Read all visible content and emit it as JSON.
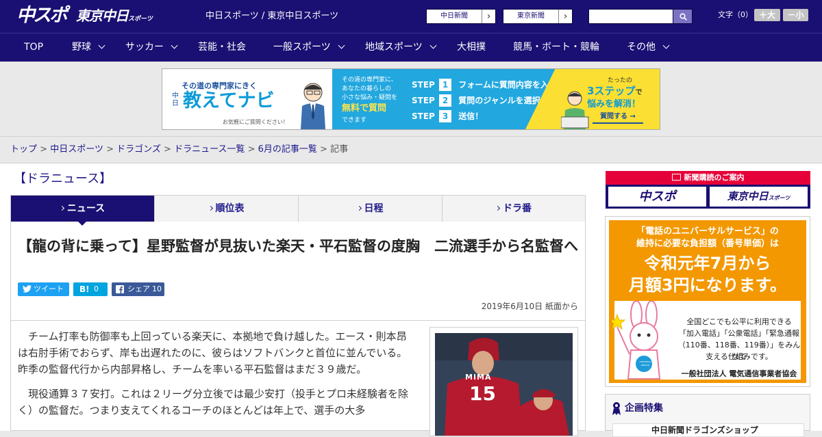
{
  "header": {
    "logo_chuspo": "中スポ",
    "logo_tokyo": "東京中日",
    "logo_tokyo_small": "スポーツ",
    "site_name": "中日スポーツ / 東京中日スポーツ",
    "btn_chunichi": "中日新聞",
    "btn_tokyo": "東京新聞",
    "arrow": "›",
    "search_placeholder": "",
    "font_size_label": "文字（0）",
    "font_bigger": "＋大",
    "font_smaller": "－小"
  },
  "nav": {
    "items": [
      {
        "label": "TOP"
      },
      {
        "label": "野球"
      },
      {
        "label": "サッカー"
      },
      {
        "label": "芸能・社会"
      },
      {
        "label": "一般スポーツ"
      },
      {
        "label": "地域スポーツ"
      },
      {
        "label": "大相撲"
      },
      {
        "label": "競馬・ボート・競輪"
      },
      {
        "label": "その他"
      }
    ]
  },
  "ad": {
    "catch": "その道の専門家にきく",
    "brand_small": "中日",
    "brand": "教えてナビ",
    "note": "お気軽にご質問ください！",
    "desc1": "その道の専門家に、",
    "desc2": "あなたの暮らしの",
    "desc3": "小さな悩み・疑問を",
    "free": "無料で質問",
    "desc4": "できます",
    "step_word": "STEP",
    "step1": "フォームに質問内容を入力",
    "step2": "質問のジャンルを選択",
    "step3": "送信！",
    "right1": "たったの",
    "right2": "3ステップ",
    "right2b": "で",
    "right3": "悩みを解消！",
    "right_btn": "質問する"
  },
  "breadcrumb": {
    "items": [
      "トップ",
      "中日スポーツ",
      "ドラゴンズ",
      "ドラニュース一覧",
      "6月の記事一覧"
    ],
    "current": "記事",
    "sep": ">"
  },
  "section_title": "【ドラニュース】",
  "tabs": [
    {
      "label": "ニュース"
    },
    {
      "label": "順位表"
    },
    {
      "label": "日程"
    },
    {
      "label": "ドラ番"
    }
  ],
  "article": {
    "title": "【龍の背に乗って】星野監督が見抜いた楽天・平石監督の度胸　二流選手から名監督へ",
    "tweet": "ツイート",
    "hatena_label": "B!",
    "hatena_count": "0",
    "share_label": "シェア",
    "share_count": "10",
    "date": "2019年6月10日 紙面から",
    "p1": "チーム打率も防御率も上回っている楽天に、本拠地で負け越した。エース・則本昂は右肘手術でおらず、岸も出遅れたのに、彼らはソフトバンクと首位に並んでいる。昨季の監督代行から内部昇格し、チームを率いる平石監督はまだ３９歳だ。",
    "p2": "現役通算３７安打。これは２リーグ分立後では最少安打（投手とプロ未経験者を除く）の監督だ。つまり支えてくれるコーチのほとんどは年上で、選手の大多"
  },
  "photo": {
    "jersey_name": "MIMA",
    "jersey_number": "15"
  },
  "sidebar": {
    "sub_header": "新聞購読のご案内",
    "sub_chuspo": "中スポ",
    "sub_tokyo": "東京中日",
    "sub_tokyo_small": "スポーツ",
    "uni_line1": "「電話のユニバーサルサービス」の",
    "uni_line2": "維持に必要な負担額（番号単価）は",
    "uni_line3": "令和元年7月から",
    "uni_line4": "月額3円になります。",
    "uni_t1": "全国どこでも公平に利用できる",
    "uni_t2": "「加入電話」「公衆電話」「緊急通報",
    "uni_t3": "（110番、118番、119番）」をみんなで",
    "uni_t4": "支える仕組みです。",
    "uni_t5": "一般社団法人 電気通信事業者協会",
    "badge": "UNIVERSAL SERVICE",
    "kikaku": "企画特集",
    "kikaku_item": "中日新聞ドラゴンズショップ"
  },
  "colors": {
    "navy": "#1a0f72",
    "twitter": "#1da1f2",
    "hatena": "#00a4de",
    "facebook": "#3b5998",
    "universal_orange": "#f39800",
    "subscribe_red": "#e60039"
  }
}
